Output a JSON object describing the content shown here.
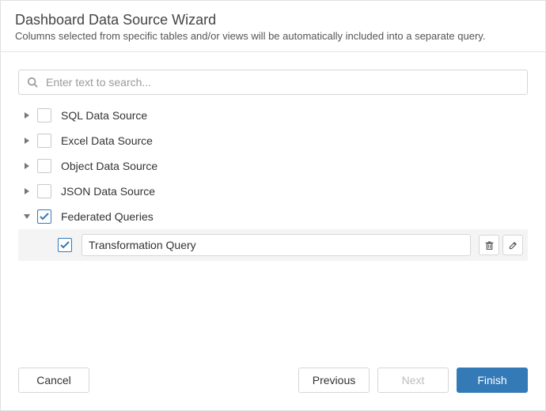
{
  "header": {
    "title": "Dashboard Data Source Wizard",
    "subtitle": "Columns selected from specific tables and/or views will be automatically included into a separate query."
  },
  "search": {
    "placeholder": "Enter text to search..."
  },
  "tree": {
    "nodes": [
      {
        "label": "SQL Data Source",
        "expanded": false,
        "checked": false
      },
      {
        "label": "Excel Data Source",
        "expanded": false,
        "checked": false
      },
      {
        "label": "Object Data Source",
        "expanded": false,
        "checked": false
      },
      {
        "label": "JSON Data Source",
        "expanded": false,
        "checked": false
      },
      {
        "label": "Federated Queries",
        "expanded": true,
        "checked": true
      }
    ],
    "child": {
      "value": "Transformation Query",
      "checked": true
    }
  },
  "footer": {
    "cancel": "Cancel",
    "previous": "Previous",
    "next": "Next",
    "finish": "Finish"
  }
}
